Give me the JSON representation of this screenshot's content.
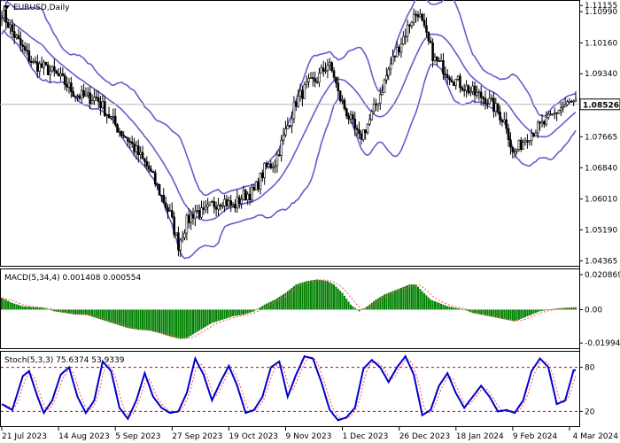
{
  "title": "EURUSD,Daily",
  "colors": {
    "background": "#ffffff",
    "frame": "#000000",
    "candle": "#000000",
    "bollinger": "#6a5acd",
    "current_price_line": "#b8b8b8",
    "macd_histogram": "#008000",
    "macd_signal": "#ff4d4d",
    "stoch_main": "#0000cc",
    "stoch_signal": "#ff4d4d",
    "stoch_levels": "#cc0000"
  },
  "chart_data": [
    {
      "type": "candlestick",
      "title": "EURUSD,Daily",
      "current_price": 1.08526,
      "current_price_label": "1.08526",
      "y_ticks": [
        "1.11155",
        "1.10990",
        "1.10160",
        "1.09340",
        "1.08526",
        "1.07665",
        "1.06840",
        "1.06010",
        "1.05190",
        "1.04365"
      ],
      "ylim": [
        1.0428,
        1.1123
      ],
      "x_ticks": [
        "21 Jul 2023",
        "14 Aug 2023",
        "5 Sep 2023",
        "27 Sep 2023",
        "19 Oct 2023",
        "9 Nov 2023",
        "1 Dec 2023",
        "26 Dec 2023",
        "18 Jan 2024",
        "9 Feb 2024",
        "4 Mar 2024"
      ],
      "indicators": [
        "Bollinger Bands"
      ],
      "price_path": [
        [
          0,
          1.11
        ],
        [
          5,
          1.1045
        ],
        [
          10,
          1.1
        ],
        [
          15,
          1.096
        ],
        [
          20,
          1.095
        ],
        [
          25,
          1.0935
        ],
        [
          30,
          1.091
        ],
        [
          35,
          1.088
        ],
        [
          40,
          1.087
        ],
        [
          45,
          1.087
        ],
        [
          50,
          1.083
        ],
        [
          55,
          1.079
        ],
        [
          60,
          1.076
        ],
        [
          65,
          1.072
        ],
        [
          70,
          1.068
        ],
        [
          75,
          1.062
        ],
        [
          80,
          1.056
        ],
        [
          84,
          1.048
        ],
        [
          88,
          1.054
        ],
        [
          92,
          1.057
        ],
        [
          96,
          1.056
        ],
        [
          100,
          1.0585
        ],
        [
          105,
          1.06
        ],
        [
          110,
          1.058
        ],
        [
          115,
          1.061
        ],
        [
          120,
          1.062
        ],
        [
          125,
          1.068
        ],
        [
          130,
          1.07
        ],
        [
          135,
          1.078
        ],
        [
          140,
          1.086
        ],
        [
          145,
          1.09
        ],
        [
          150,
          1.092
        ],
        [
          155,
          1.096
        ],
        [
          158,
          1.093
        ],
        [
          160,
          1.088
        ],
        [
          165,
          1.082
        ],
        [
          170,
          1.076
        ],
        [
          175,
          1.081
        ],
        [
          180,
          1.088
        ],
        [
          185,
          1.096
        ],
        [
          190,
          1.102
        ],
        [
          195,
          1.108
        ],
        [
          198,
          1.11
        ],
        [
          202,
          1.103
        ],
        [
          206,
          1.097
        ],
        [
          210,
          1.095
        ],
        [
          215,
          1.092
        ],
        [
          220,
          1.09
        ],
        [
          225,
          1.088
        ],
        [
          230,
          1.087
        ],
        [
          235,
          1.084
        ],
        [
          240,
          1.08
        ],
        [
          243,
          1.072
        ],
        [
          246,
          1.074
        ],
        [
          250,
          1.077
        ],
        [
          255,
          1.079
        ],
        [
          260,
          1.081
        ],
        [
          265,
          1.084
        ],
        [
          270,
          1.0855
        ],
        [
          273,
          1.0853
        ]
      ]
    },
    {
      "type": "bar",
      "title": "MACD(5,34,4) 0.001408 0.000554",
      "y_ticks": [
        "0.020869",
        "0.00",
        "-0.019942"
      ],
      "ylim": [
        -0.0225,
        0.0235
      ],
      "histogram_path": [
        [
          0,
          0.007
        ],
        [
          5,
          0.004
        ],
        [
          10,
          0.002
        ],
        [
          15,
          0.0015
        ],
        [
          20,
          0.001
        ],
        [
          25,
          -0.001
        ],
        [
          30,
          -0.002
        ],
        [
          35,
          -0.003
        ],
        [
          40,
          -0.003
        ],
        [
          45,
          -0.005
        ],
        [
          50,
          -0.007
        ],
        [
          55,
          -0.009
        ],
        [
          60,
          -0.011
        ],
        [
          65,
          -0.012
        ],
        [
          70,
          -0.0125
        ],
        [
          75,
          -0.014
        ],
        [
          80,
          -0.016
        ],
        [
          85,
          -0.0175
        ],
        [
          88,
          -0.017
        ],
        [
          92,
          -0.014
        ],
        [
          96,
          -0.011
        ],
        [
          100,
          -0.008
        ],
        [
          105,
          -0.006
        ],
        [
          110,
          -0.004
        ],
        [
          115,
          -0.003
        ],
        [
          120,
          -0.001
        ],
        [
          125,
          0.003
        ],
        [
          130,
          0.006
        ],
        [
          135,
          0.01
        ],
        [
          140,
          0.015
        ],
        [
          145,
          0.017
        ],
        [
          150,
          0.018
        ],
        [
          155,
          0.017
        ],
        [
          158,
          0.015
        ],
        [
          162,
          0.01
        ],
        [
          166,
          0.003
        ],
        [
          170,
          -0.001
        ],
        [
          174,
          0.002
        ],
        [
          178,
          0.006
        ],
        [
          182,
          0.009
        ],
        [
          186,
          0.011
        ],
        [
          190,
          0.013
        ],
        [
          194,
          0.015
        ],
        [
          197,
          0.015
        ],
        [
          200,
          0.011
        ],
        [
          204,
          0.006
        ],
        [
          208,
          0.004
        ],
        [
          212,
          0.002
        ],
        [
          216,
          0.001
        ],
        [
          220,
          0.0
        ],
        [
          224,
          -0.002
        ],
        [
          228,
          -0.003
        ],
        [
          232,
          -0.004
        ],
        [
          236,
          -0.005
        ],
        [
          240,
          -0.006
        ],
        [
          244,
          -0.007
        ],
        [
          248,
          -0.005
        ],
        [
          252,
          -0.003
        ],
        [
          256,
          -0.001
        ],
        [
          260,
          0.0
        ],
        [
          265,
          0.0008
        ],
        [
          270,
          0.0012
        ],
        [
          273,
          0.0014
        ]
      ]
    },
    {
      "type": "line",
      "title": "Stoch(5,3,3) 75.6374 53.9339",
      "y_ticks": [
        "80",
        "20"
      ],
      "ylim": [
        0,
        100
      ],
      "levels": [
        80,
        20
      ],
      "series": [
        {
          "name": "",
          "values": [
            [
              0,
              30
            ],
            [
              5,
              22
            ],
            [
              10,
              68
            ],
            [
              13,
              75
            ],
            [
              17,
              40
            ],
            [
              20,
              18
            ],
            [
              24,
              35
            ],
            [
              28,
              70
            ],
            [
              32,
              80
            ],
            [
              36,
              40
            ],
            [
              40,
              18
            ],
            [
              44,
              35
            ],
            [
              48,
              88
            ],
            [
              52,
              75
            ],
            [
              56,
              25
            ],
            [
              60,
              10
            ],
            [
              64,
              35
            ],
            [
              68,
              72
            ],
            [
              72,
              40
            ],
            [
              76,
              25
            ],
            [
              80,
              18
            ],
            [
              84,
              20
            ],
            [
              88,
              45
            ],
            [
              92,
              92
            ],
            [
              96,
              70
            ],
            [
              100,
              35
            ],
            [
              104,
              60
            ],
            [
              108,
              82
            ],
            [
              112,
              55
            ],
            [
              116,
              18
            ],
            [
              120,
              22
            ],
            [
              124,
              40
            ],
            [
              128,
              80
            ],
            [
              132,
              88
            ],
            [
              136,
              40
            ],
            [
              140,
              70
            ],
            [
              144,
              95
            ],
            [
              148,
              92
            ],
            [
              152,
              60
            ],
            [
              156,
              22
            ],
            [
              160,
              8
            ],
            [
              164,
              12
            ],
            [
              168,
              25
            ],
            [
              172,
              78
            ],
            [
              176,
              90
            ],
            [
              180,
              80
            ],
            [
              184,
              60
            ],
            [
              188,
              80
            ],
            [
              192,
              95
            ],
            [
              196,
              70
            ],
            [
              200,
              15
            ],
            [
              204,
              22
            ],
            [
              208,
              55
            ],
            [
              212,
              72
            ],
            [
              216,
              45
            ],
            [
              220,
              25
            ],
            [
              224,
              40
            ],
            [
              228,
              55
            ],
            [
              232,
              40
            ],
            [
              236,
              20
            ],
            [
              240,
              22
            ],
            [
              244,
              18
            ],
            [
              248,
              35
            ],
            [
              252,
              75
            ],
            [
              256,
              92
            ],
            [
              260,
              80
            ],
            [
              264,
              30
            ],
            [
              268,
              35
            ],
            [
              272,
              76
            ]
          ]
        }
      ]
    }
  ]
}
